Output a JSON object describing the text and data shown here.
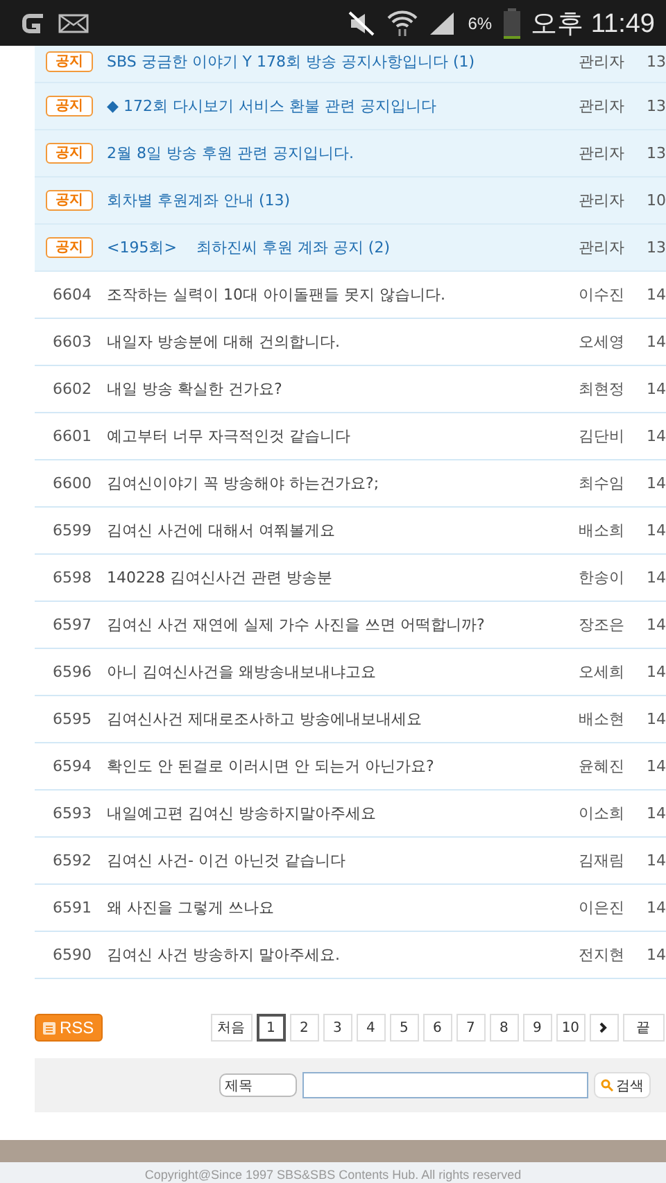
{
  "status_bar": {
    "battery": "6%",
    "time": "오후 11:49"
  },
  "notices": [
    {
      "badge": "공지",
      "title": "SBS 궁금한 이야기 Y 178회 방송 공지사항입니다 (1)",
      "author": "관리자",
      "date": "13",
      "partial": true
    },
    {
      "badge": "공지",
      "title": "◆ 172회 다시보기 서비스 환불 관련 공지입니다",
      "author": "관리자",
      "date": "13",
      "partial": false
    },
    {
      "badge": "공지",
      "title": "2월 8일 방송 후원 관련 공지입니다.",
      "author": "관리자",
      "date": "13",
      "partial": false
    },
    {
      "badge": "공지",
      "title": "회차별 후원계좌 안내 (13)",
      "author": "관리자",
      "date": "10",
      "partial": false
    },
    {
      "badge": "공지",
      "title": "<195회>    최하진씨 후원 계좌 공지 (2)",
      "author": "관리자",
      "date": "13",
      "partial": false
    }
  ],
  "posts": [
    {
      "number": "6604",
      "title": "조작하는 실력이 10대 아이돌팬들 못지 않습니다.",
      "author": "이수진",
      "date": "14"
    },
    {
      "number": "6603",
      "title": "내일자 방송분에 대해 건의합니다.",
      "author": "오세영",
      "date": "14"
    },
    {
      "number": "6602",
      "title": "내일 방송 확실한 건가요?",
      "author": "최현정",
      "date": "14"
    },
    {
      "number": "6601",
      "title": "예고부터 너무 자극적인것 같습니다",
      "author": "김단비",
      "date": "14"
    },
    {
      "number": "6600",
      "title": "김여신이야기 꼭 방송해야 하는건가요?;",
      "author": "최수임",
      "date": "14"
    },
    {
      "number": "6599",
      "title": "김여신 사건에 대해서 여쭤볼게요",
      "author": "배소희",
      "date": "14"
    },
    {
      "number": "6598",
      "title": "140228 김여신사건 관련 방송분",
      "author": "한송이",
      "date": "14"
    },
    {
      "number": "6597",
      "title": "김여신 사건 재연에 실제 가수 사진을 쓰면 어떡합니까?",
      "author": "장조은",
      "date": "14"
    },
    {
      "number": "6596",
      "title": "아니 김여신사건을 왜방송내보내냐고요",
      "author": "오세희",
      "date": "14"
    },
    {
      "number": "6595",
      "title": "김여신사건 제대로조사하고 방송에내보내세요",
      "author": "배소현",
      "date": "14"
    },
    {
      "number": "6594",
      "title": "확인도 안 된걸로 이러시면 안 되는거 아닌가요?",
      "author": "윤혜진",
      "date": "14"
    },
    {
      "number": "6593",
      "title": "내일예고편 김여신 방송하지말아주세요",
      "author": "이소희",
      "date": "14"
    },
    {
      "number": "6592",
      "title": "김여신 사건- 이건 아닌것 같습니다",
      "author": "김재림",
      "date": "14"
    },
    {
      "number": "6591",
      "title": "왜 사진을 그렇게 쓰나요",
      "author": "이은진",
      "date": "14"
    },
    {
      "number": "6590",
      "title": "김여신 사건 방송하지 말아주세요.",
      "author": "전지현",
      "date": "14"
    }
  ],
  "rss_button": "RSS",
  "pagination": {
    "first": "처음",
    "last": "끝",
    "pages": [
      {
        "label": "1",
        "selected": true
      },
      {
        "label": "2",
        "selected": false
      },
      {
        "label": "3",
        "selected": false
      },
      {
        "label": "4",
        "selected": false
      },
      {
        "label": "5",
        "selected": false
      },
      {
        "label": "6",
        "selected": false
      },
      {
        "label": "7",
        "selected": false
      },
      {
        "label": "8",
        "selected": false
      },
      {
        "label": "9",
        "selected": false
      },
      {
        "label": "10",
        "selected": false
      }
    ]
  },
  "search": {
    "scope": "제목",
    "button": "검색"
  },
  "footer": {
    "copyright": "Copyright@Since 1997 SBS&SBS Contents Hub. All rights reserved"
  }
}
